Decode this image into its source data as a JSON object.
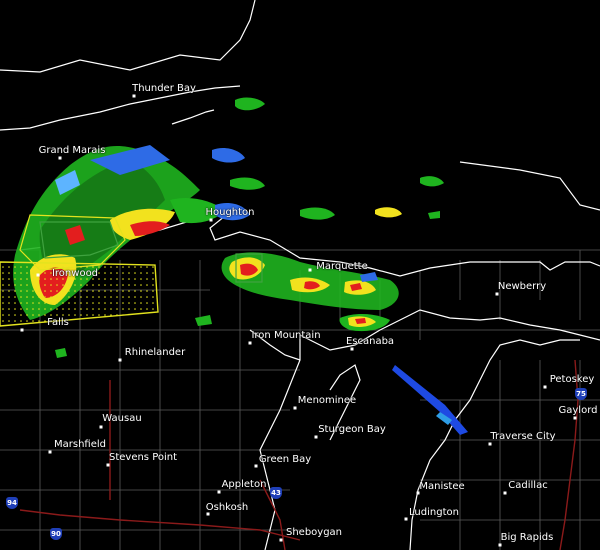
{
  "map": {
    "colors": {
      "background": "#000000",
      "land_border": "#ffffff",
      "county_line": "#5a5a5a",
      "highway": "#8b1a1a",
      "warning_box": "#e3e31e",
      "watch_box": "#3fa23f",
      "radar_light": "#1fb41f",
      "radar_moderate": "#f2e21e",
      "radar_heavy": "#e31e1e",
      "radar_blue": "#1e4ae3"
    },
    "cities": [
      {
        "name": "Thunder Bay"
      },
      {
        "name": "Grand Marais"
      },
      {
        "name": "Houghton"
      },
      {
        "name": "Ironwood"
      },
      {
        "name": "Marquette"
      },
      {
        "name": "Newberry"
      },
      {
        "name": "Iron Mountain"
      },
      {
        "name": "Escanaba"
      },
      {
        "name": "Rhinelander"
      },
      {
        "name": "Petoskey"
      },
      {
        "name": "Menominee"
      },
      {
        "name": "Gaylord"
      },
      {
        "name": "Wausau"
      },
      {
        "name": "Sturgeon Bay"
      },
      {
        "name": "Traverse City"
      },
      {
        "name": "Marshfield"
      },
      {
        "name": "Stevens Point"
      },
      {
        "name": "Green Bay"
      },
      {
        "name": "Appleton"
      },
      {
        "name": "Manistee"
      },
      {
        "name": "Cadillac"
      },
      {
        "name": "Oshkosh"
      },
      {
        "name": "Ludington"
      },
      {
        "name": "Sheboygan"
      },
      {
        "name": "Big Rapids"
      },
      {
        "name": "Falls"
      }
    ],
    "shields": [
      {
        "label": "75",
        "kind": "interstate"
      },
      {
        "label": "43",
        "kind": "interstate"
      },
      {
        "label": "94",
        "kind": "interstate"
      },
      {
        "label": "90",
        "kind": "interstate"
      }
    ]
  }
}
